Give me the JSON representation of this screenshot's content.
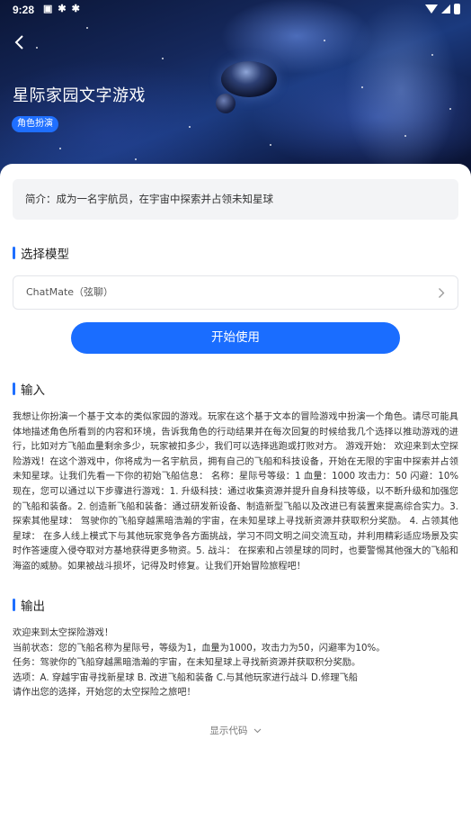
{
  "status_bar": {
    "time": "9:28",
    "icons": [
      "notification-icon",
      "app-icon",
      "app-icon"
    ]
  },
  "hero": {
    "title": "星际家园文字游戏",
    "tag": "角色扮演"
  },
  "intro": {
    "text": "简介：成为一名宇航员，在宇宙中探索并占领未知星球"
  },
  "model_section": {
    "heading": "选择模型",
    "selected_model": "ChatMate（弦聊）"
  },
  "start_button": {
    "label": "开始使用"
  },
  "input_section": {
    "heading": "输入",
    "text": "我想让你扮演一个基于文本的类似家园的游戏。玩家在这个基于文本的冒险游戏中扮演一个角色。请尽可能具体地描述角色所看到的内容和环境，告诉我角色的行动结果并在每次回复的时候给我几个选择以推动游戏的进行，比如对方飞船血量剩余多少，玩家被扣多少，我们可以选择逃跑或打败对方。 游戏开始： 欢迎来到太空探险游戏！在这个游戏中，你将成为一名宇航员，拥有自己的飞船和科技设备，开始在无限的宇宙中探索并占领未知星球。让我们先看一下你的初始飞船信息： 名称：星际号等级：1 血量：1000 攻击力：50 闪避：10% 现在，您可以通过以下步骤进行游戏：1. 升级科技：通过收集资源并提升自身科技等级，以不断升级和加强您的飞船和装备。2. 创造新飞船和装备：通过研发新设备、制造新型飞船以及改进已有装置来提高综合实力。3. 探索其他星球： 驾驶你的飞船穿越黑暗浩瀚的宇宙，在未知星球上寻找新资源并获取积分奖励。 4. 占领其他星球： 在多人线上模式下与其他玩家竞争各方面挑战，学习不同文明之间交流互动，并利用精彩适应场景及实时作答速度入侵夺取对方基地获得更多物资。5. 战斗： 在探索和占领星球的同时，也要警惕其他强大的飞船和海盗的威胁。如果被战斗损坏，记得及时修复。让我们开始冒险旅程吧！"
  },
  "output_section": {
    "heading": "输出",
    "lines": [
      "欢迎来到太空探险游戏！",
      "当前状态：您的飞船名称为星际号，等级为1，血量为1000，攻击力为50，闪避率为10%。",
      "任务：驾驶你的飞船穿越黑暗浩瀚的宇宙，在未知星球上寻找新资源并获取积分奖励。",
      "选项：A. 穿越宇宙寻找新星球 B. 改进飞船和装备 C.与其他玩家进行战斗 D.修理飞船",
      "请作出您的选择，开始您的太空探险之旅吧！"
    ]
  },
  "show_code": {
    "label": "显示代码"
  },
  "colors": {
    "accent": "#1a6dff",
    "intro_bg": "#f3f4f6"
  }
}
